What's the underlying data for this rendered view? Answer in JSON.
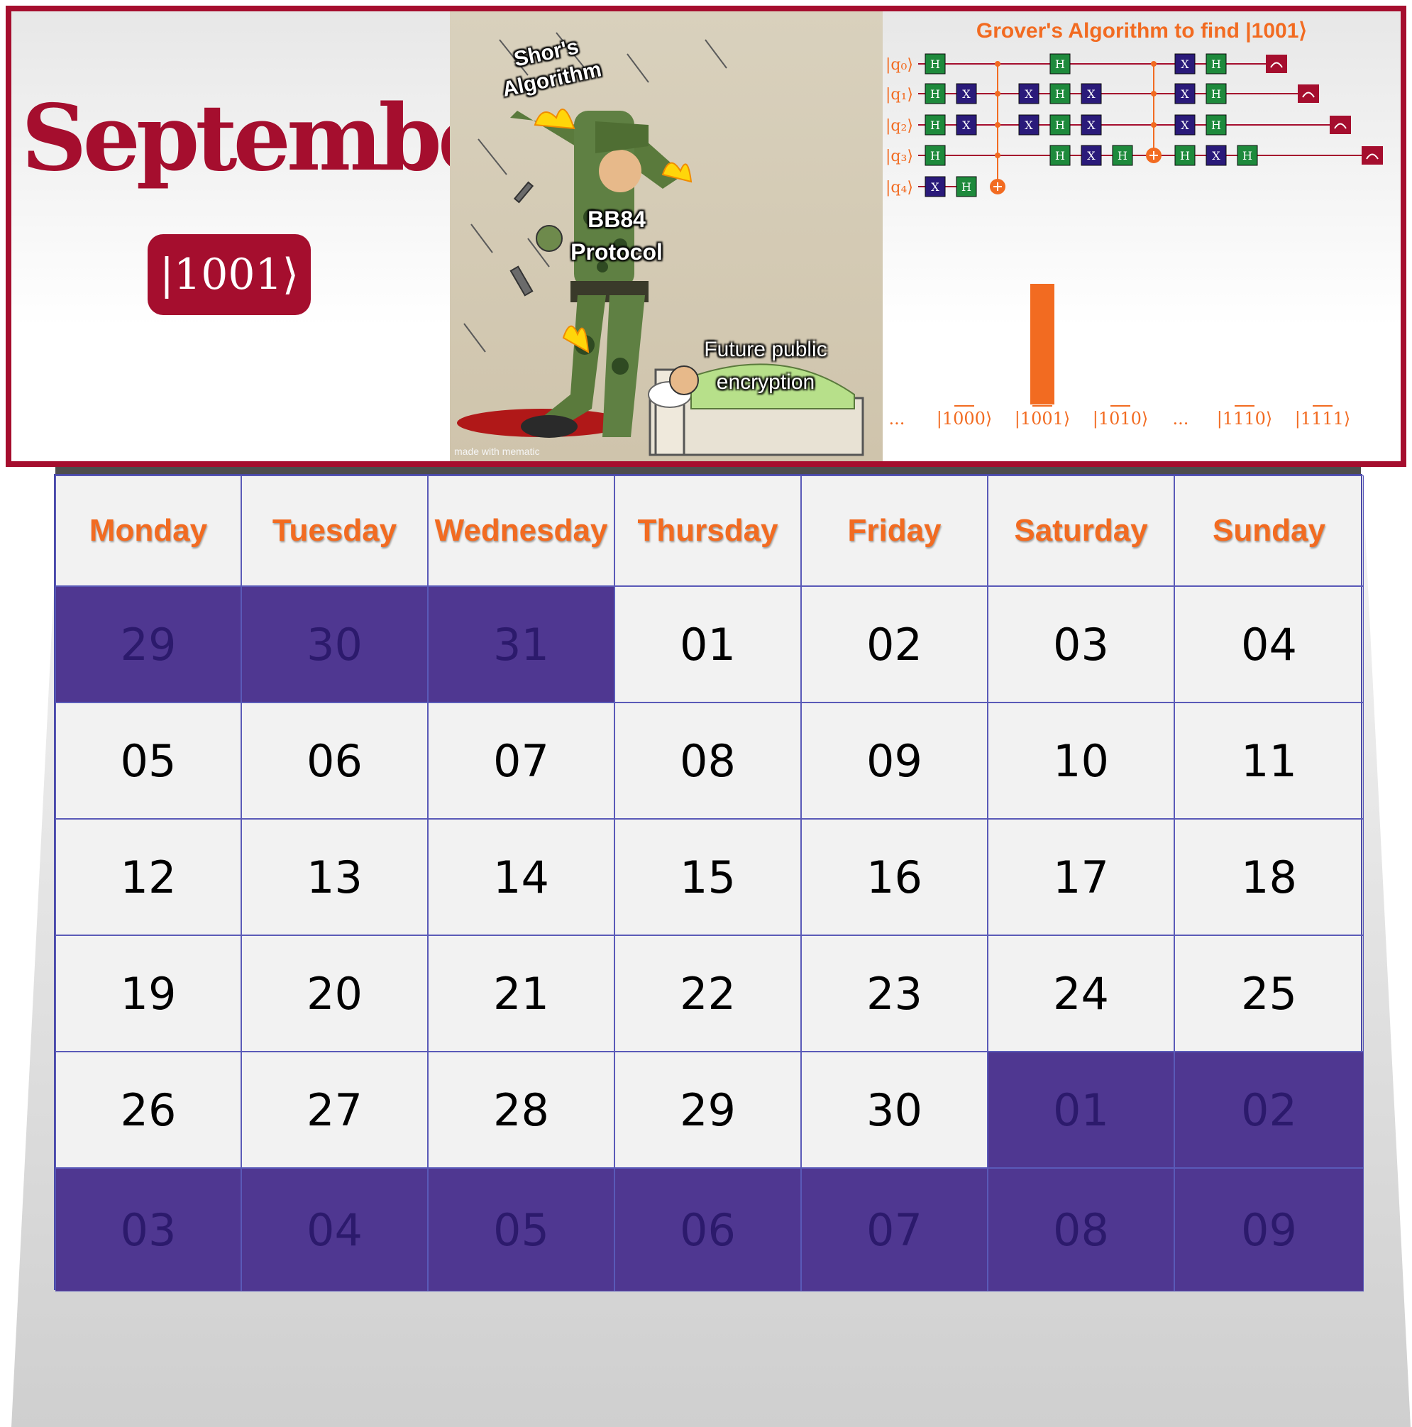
{
  "header": {
    "month": "September",
    "ket": "|1001⟩"
  },
  "meme": {
    "labels": {
      "shor": "Shor's Algorithm",
      "bb84": "BB84 Protocol",
      "future": "Future public encryption"
    },
    "watermark": "made with mematic"
  },
  "circuit": {
    "title": "Grover's Algorithm to find |1001⟩",
    "qubits": [
      "|q₀⟩",
      "|q₁⟩",
      "|q₂⟩",
      "|q₃⟩",
      "|q₄⟩"
    ],
    "histogram_labels": [
      "...",
      "|1000⟩",
      "|1001⟩",
      "|1010⟩",
      "...",
      "|1110⟩",
      "|1111⟩"
    ],
    "colors": {
      "hadamard": "#1e8a3c",
      "x_gate": "#2a1a7a",
      "measure": "#a50e2e",
      "wire": "#a50e2e",
      "control": "#f26b21"
    }
  },
  "calendar": {
    "days": [
      "Monday",
      "Tuesday",
      "Wednesday",
      "Thursday",
      "Friday",
      "Saturday",
      "Sunday"
    ],
    "weeks": [
      [
        {
          "d": "29",
          "out": true
        },
        {
          "d": "30",
          "out": true
        },
        {
          "d": "31",
          "out": true
        },
        {
          "d": "01"
        },
        {
          "d": "02"
        },
        {
          "d": "03"
        },
        {
          "d": "04"
        }
      ],
      [
        {
          "d": "05"
        },
        {
          "d": "06"
        },
        {
          "d": "07"
        },
        {
          "d": "08"
        },
        {
          "d": "09"
        },
        {
          "d": "10"
        },
        {
          "d": "11"
        }
      ],
      [
        {
          "d": "12"
        },
        {
          "d": "13"
        },
        {
          "d": "14"
        },
        {
          "d": "15"
        },
        {
          "d": "16"
        },
        {
          "d": "17"
        },
        {
          "d": "18"
        }
      ],
      [
        {
          "d": "19"
        },
        {
          "d": "20"
        },
        {
          "d": "21"
        },
        {
          "d": "22"
        },
        {
          "d": "23"
        },
        {
          "d": "24"
        },
        {
          "d": "25"
        }
      ],
      [
        {
          "d": "26"
        },
        {
          "d": "27"
        },
        {
          "d": "28"
        },
        {
          "d": "29"
        },
        {
          "d": "30"
        },
        {
          "d": "01",
          "out": true
        },
        {
          "d": "02",
          "out": true
        }
      ],
      [
        {
          "d": "03",
          "out": true
        },
        {
          "d": "04",
          "out": true
        },
        {
          "d": "05",
          "out": true
        },
        {
          "d": "06",
          "out": true
        },
        {
          "d": "07",
          "out": true
        },
        {
          "d": "08",
          "out": true
        },
        {
          "d": "09",
          "out": true
        }
      ]
    ],
    "colors": {
      "out_of_month": "#4f3791",
      "header_text": "#f26b21",
      "accent": "#a50e2e"
    }
  }
}
